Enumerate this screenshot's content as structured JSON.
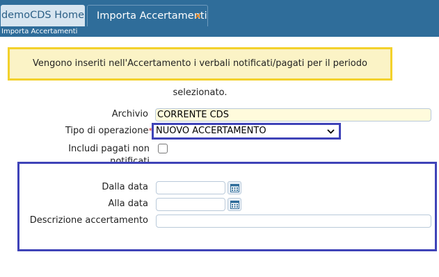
{
  "tabs": [
    {
      "label": "demoCDS Home"
    },
    {
      "label": "Importa Accertamenti",
      "close_glyph": "×"
    }
  ],
  "breadcrumb": "Importa Accertamenti",
  "notice": "Vengono inseriti nell'Accertamento i verbali notificati/pagati per il periodo selezionato.",
  "form": {
    "archivio": {
      "label": "Archivio",
      "value": "CORRENTE CDS"
    },
    "tipo_operazione": {
      "label": "Tipo di operazione",
      "required_mark": "*",
      "value": "NUOVO ACCERTAMENTO"
    },
    "includi_pagati": {
      "label": "Includi pagati non notificati",
      "checked": false
    },
    "dalla_data": {
      "label": "Dalla data",
      "value": ""
    },
    "alla_data": {
      "label": "Alla data",
      "value": ""
    },
    "descrizione": {
      "label": "Descrizione accertamento",
      "value": ""
    }
  },
  "colors": {
    "tabbar": "#2f6d9a",
    "notice_border": "#f3d12b",
    "notice_bg": "#fbf3c6",
    "highlight_border": "#3f43b8",
    "close_icon": "#f28a1e"
  },
  "icons": [
    "close-icon",
    "chevron-down-icon",
    "calendar-icon"
  ]
}
